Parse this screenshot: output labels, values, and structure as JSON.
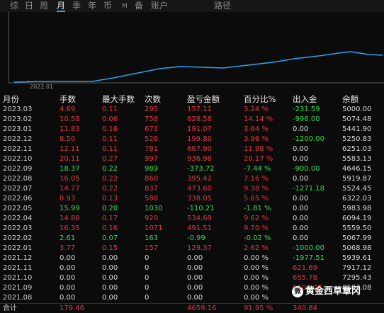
{
  "tabs": [
    {
      "label": "综",
      "active": false
    },
    {
      "label": "日",
      "active": false
    },
    {
      "label": "周",
      "active": false
    },
    {
      "label": "月",
      "active": true
    },
    {
      "label": "季",
      "active": false
    },
    {
      "label": "年",
      "active": false
    },
    {
      "label": "币",
      "active": false
    },
    {
      "label": "M",
      "active": false
    },
    {
      "label": "备",
      "active": false
    },
    {
      "label": "账户",
      "active": false
    },
    {
      "label": "路径",
      "active": false
    }
  ],
  "chart": {
    "x_tick": "2022.01",
    "line_color": "#29a3f0"
  },
  "table": {
    "headers": [
      "月份",
      "手数",
      "最大手数",
      "次数",
      "盈亏金额",
      "百分比%",
      "出入金",
      "余额"
    ],
    "rows": [
      {
        "month": "2023.03",
        "lots": "4.69",
        "max_lots": "0.11",
        "count": "295",
        "pnl": "157.11",
        "pct": "3.24 %",
        "flow": "-231.59",
        "balance": "5000.00",
        "tone": "red",
        "flow_tone": "green"
      },
      {
        "month": "2023.02",
        "lots": "10.58",
        "max_lots": "0.06",
        "count": "758",
        "pnl": "628.58",
        "pct": "14.14 %",
        "flow": "-996.00",
        "balance": "5074.48",
        "tone": "red",
        "flow_tone": "green"
      },
      {
        "month": "2023.01",
        "lots": "11.83",
        "max_lots": "0.16",
        "count": "673",
        "pnl": "191.07",
        "pct": "3.64 %",
        "flow": "0.00",
        "balance": "5441.90",
        "tone": "red",
        "flow_tone": "white"
      },
      {
        "month": "2022.12",
        "lots": "8.50",
        "max_lots": "0.11",
        "count": "526",
        "pnl": "199.80",
        "pct": "3.96 %",
        "flow": "-1200.00",
        "balance": "5250.83",
        "tone": "red",
        "flow_tone": "green"
      },
      {
        "month": "2022.11",
        "lots": "12.11",
        "max_lots": "0.11",
        "count": "781",
        "pnl": "667.90",
        "pct": "11.98 %",
        "flow": "0.00",
        "balance": "6251.03",
        "tone": "red",
        "flow_tone": "white"
      },
      {
        "month": "2022.10",
        "lots": "20.11",
        "max_lots": "0.27",
        "count": "997",
        "pnl": "936.98",
        "pct": "20.17 %",
        "flow": "0.00",
        "balance": "5583.13",
        "tone": "red",
        "flow_tone": "white"
      },
      {
        "month": "2022.09",
        "lots": "18.37",
        "max_lots": "0.22",
        "count": "989",
        "pnl": "-373.72",
        "pct": "-7.44 %",
        "flow": "-900.00",
        "balance": "4646.15",
        "tone": "green",
        "flow_tone": "green"
      },
      {
        "month": "2022.08",
        "lots": "16.05",
        "max_lots": "0.22",
        "count": "860",
        "pnl": "395.42",
        "pct": "7.16 %",
        "flow": "0.00",
        "balance": "5919.87",
        "tone": "red",
        "flow_tone": "white"
      },
      {
        "month": "2022.07",
        "lots": "14.77",
        "max_lots": "0.22",
        "count": "837",
        "pnl": "473.60",
        "pct": "9.38 %",
        "flow": "-1271.18",
        "balance": "5524.45",
        "tone": "red",
        "flow_tone": "green"
      },
      {
        "month": "2022.06",
        "lots": "8.93",
        "max_lots": "0.13",
        "count": "588",
        "pnl": "338.05",
        "pct": "5.65 %",
        "flow": "0.00",
        "balance": "6322.03",
        "tone": "red",
        "flow_tone": "white"
      },
      {
        "month": "2022.05",
        "lots": "15.99",
        "max_lots": "0.20",
        "count": "1030",
        "pnl": "-110.21",
        "pct": "-1.81 %",
        "flow": "0.00",
        "balance": "5983.98",
        "tone": "green",
        "flow_tone": "white"
      },
      {
        "month": "2022.04",
        "lots": "14.80",
        "max_lots": "0.17",
        "count": "920",
        "pnl": "534.69",
        "pct": "9.62 %",
        "flow": "0.00",
        "balance": "6094.19",
        "tone": "red",
        "flow_tone": "white"
      },
      {
        "month": "2022.03",
        "lots": "16.35",
        "max_lots": "0.16",
        "count": "1071",
        "pnl": "491.51",
        "pct": "9.70 %",
        "flow": "0.00",
        "balance": "5559.50",
        "tone": "red",
        "flow_tone": "white"
      },
      {
        "month": "2022.02",
        "lots": "2.61",
        "max_lots": "0.07",
        "count": "163",
        "pnl": "-0.99",
        "pct": "-0.02 %",
        "flow": "0.00",
        "balance": "5067.99",
        "tone": "green",
        "flow_tone": "white"
      },
      {
        "month": "2022.01",
        "lots": "3.77",
        "max_lots": "0.15",
        "count": "157",
        "pnl": "129.37",
        "pct": "2.62 %",
        "flow": "-1000.00",
        "balance": "5068.98",
        "tone": "red",
        "flow_tone": "green"
      },
      {
        "month": "2021.12",
        "lots": "0.00",
        "max_lots": "0.00",
        "count": "0",
        "pnl": "0.00",
        "pct": "0.00 %",
        "flow": "-1977.51",
        "balance": "5939.61",
        "tone": "white",
        "flow_tone": "green"
      },
      {
        "month": "2021.11",
        "lots": "0.00",
        "max_lots": "0.00",
        "count": "0",
        "pnl": "0.00",
        "pct": "0.00 %",
        "flow": "621.69",
        "balance": "7917.12",
        "tone": "white",
        "flow_tone": "red"
      },
      {
        "month": "2021.10",
        "lots": "0.00",
        "max_lots": "0.00",
        "count": "0",
        "pnl": "0.00",
        "pct": "0.00 %",
        "flow": "655.78",
        "balance": "7295.43",
        "tone": "white",
        "flow_tone": "red"
      },
      {
        "month": "2021.09",
        "lots": "0.00",
        "max_lots": "0.00",
        "count": "0",
        "pnl": "0.00",
        "pct": "0.00 %",
        "flow": "6103.08",
        "balance": "6103.08",
        "tone": "white",
        "flow_tone": "red"
      },
      {
        "month": "2021.08",
        "lots": "0.00",
        "max_lots": "0.00",
        "count": "0",
        "pnl": "0.00",
        "pct": "0.00 %",
        "flow": "",
        "balance": "",
        "tone": "white",
        "flow_tone": "white"
      }
    ],
    "total": {
      "label": "合计",
      "lots": "179.46",
      "pnl": "4659.16",
      "pct": "91.95 %",
      "flow": "340.84"
    }
  },
  "watermark": {
    "text": "黄金西草章冈",
    "icon": "weibo-icon"
  },
  "colors": {
    "up": "#e03a3a",
    "down": "#33dd55",
    "line": "#29a3f0",
    "active_tab": "#3ea0ff"
  }
}
